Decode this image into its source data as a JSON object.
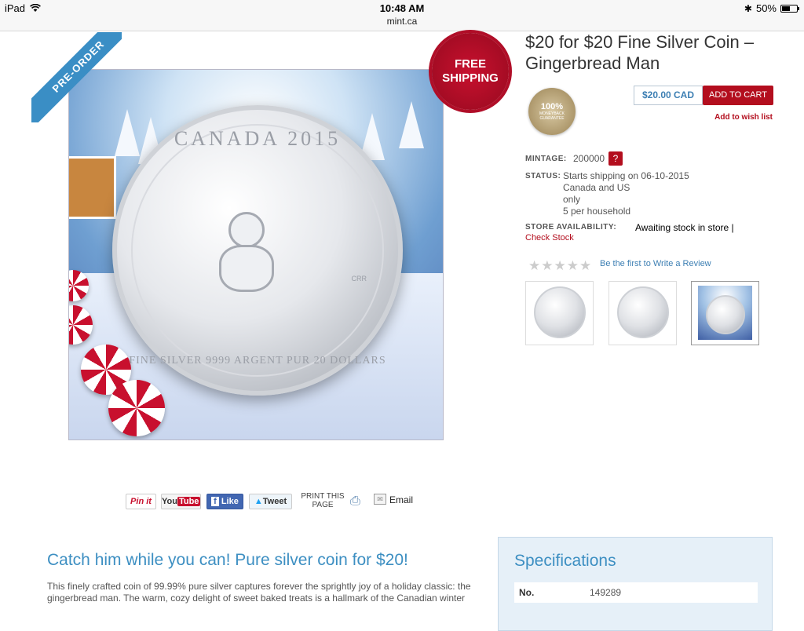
{
  "status_bar": {
    "device": "iPad",
    "time": "10:48 AM",
    "url": "mint.ca",
    "battery": "50%"
  },
  "product": {
    "title": "$20 for $20 Fine Silver Coin – Gingerbread Man",
    "preorder_ribbon": "PRE-ORDER",
    "free_shipping_line1": "FREE",
    "free_shipping_line2": "SHIPPING",
    "coin_top_text": "CANADA 2015",
    "coin_bottom_text": "FINE SILVER 9999 ARGENT PUR 20 DOLLARS",
    "coin_mark": "CRR",
    "guarantee_pct": "100%",
    "guarantee_line1": "MONEYBACK",
    "guarantee_line2": "GUARANTEE",
    "price": "$20.00 CAD",
    "add_to_cart": "ADD TO CART",
    "wish_list": "Add to wish list",
    "mintage_label": "MINTAGE:",
    "mintage_value": "200000",
    "help_badge": "?",
    "status_label": "STATUS:",
    "status_line1": "Starts shipping on 06-10-2015",
    "status_line2": "Canada and US",
    "status_line3": "only",
    "status_line4": "5 per household",
    "store_label": "STORE AVAILABILITY:",
    "store_value": "Awaiting stock in store |",
    "check_stock": "Check Stock",
    "stars": "★★★★★",
    "review_link": "Be the first to Write a Review"
  },
  "share": {
    "pinit": "Pin it",
    "youtube_you": "You",
    "youtube_tube": "Tube",
    "facebook": "Like",
    "twitter": "Tweet",
    "print_line1": "PRINT THIS",
    "print_line2": "PAGE",
    "email": "Email"
  },
  "description": {
    "heading": "Catch him while you can! Pure silver coin for $20!",
    "body": "This finely crafted coin of 99.99% pure silver captures forever the sprightly joy of a holiday classic: the gingerbread man. The warm, cozy delight of sweet baked treats is a hallmark of the Canadian winter"
  },
  "specifications": {
    "title": "Specifications",
    "rows": [
      {
        "key": "No.",
        "value": "149289"
      }
    ]
  },
  "colors": {
    "accent_blue": "#3d8fc2",
    "brand_red": "#b30e1e"
  }
}
